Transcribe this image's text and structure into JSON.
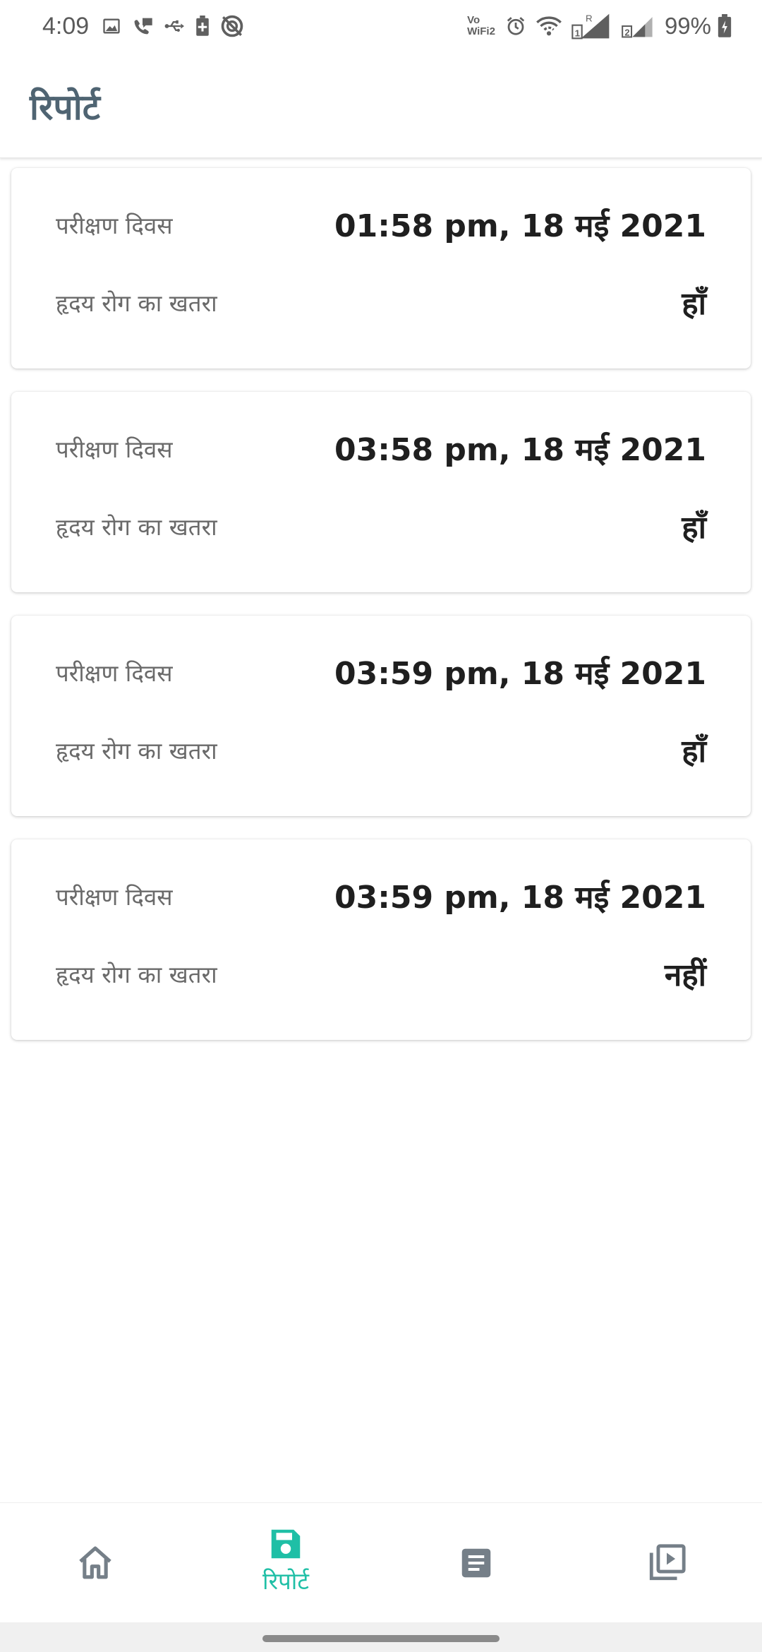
{
  "status_bar": {
    "time": "4:09",
    "vowifi_top": "Vo",
    "vowifi_bottom": "WiFi2",
    "battery_percent": "99%",
    "icons": [
      "image-icon",
      "chat-icon",
      "usb-icon",
      "battery-saver-icon",
      "data-saver-icon",
      "alarm-icon",
      "wifi-icon",
      "signal-sim1-icon",
      "signal-sim2-icon",
      "battery-icon"
    ]
  },
  "app_bar": {
    "title": "रिपोर्ट"
  },
  "reports": [
    {
      "date_label": "परीक्षण दिवस",
      "date_value": "01:58 pm, 18 मई 2021",
      "risk_label": "हृदय रोग का खतरा",
      "risk_value": "हाँ"
    },
    {
      "date_label": "परीक्षण दिवस",
      "date_value": "03:58 pm, 18 मई 2021",
      "risk_label": "हृदय रोग का खतरा",
      "risk_value": "हाँ"
    },
    {
      "date_label": "परीक्षण दिवस",
      "date_value": "03:59 pm, 18 मई 2021",
      "risk_label": "हृदय रोग का खतरा",
      "risk_value": "हाँ"
    },
    {
      "date_label": "परीक्षण दिवस",
      "date_value": "03:59 pm, 18 मई 2021",
      "risk_label": "हृदय रोग का खतरा",
      "risk_value": "नहीं"
    }
  ],
  "bottom_nav": {
    "items": [
      {
        "icon": "home-icon",
        "label": "",
        "active": false
      },
      {
        "icon": "save-icon",
        "label": "रिपोर्ट",
        "active": true
      },
      {
        "icon": "article-icon",
        "label": "",
        "active": false
      },
      {
        "icon": "video-library-icon",
        "label": "",
        "active": false
      }
    ],
    "active_color": "#1fbfa6",
    "inactive_color": "#757f88"
  },
  "colors": {
    "title": "#4f6472",
    "label": "#6a6a6a",
    "value": "#1f1f1f"
  }
}
